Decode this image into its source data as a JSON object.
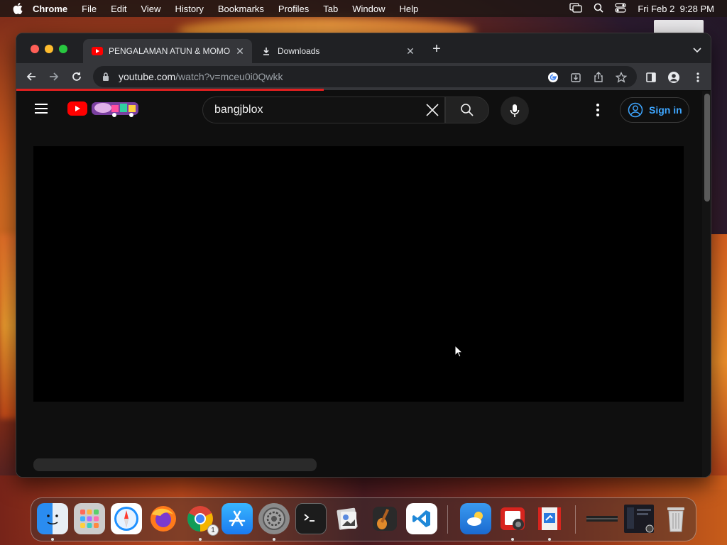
{
  "menubar": {
    "app": "Chrome",
    "items": [
      "File",
      "Edit",
      "View",
      "History",
      "Bookmarks",
      "Profiles",
      "Tab",
      "Window",
      "Help"
    ],
    "clock": "Fri Feb 2  9:28 PM"
  },
  "browser": {
    "tabs": [
      {
        "title": "PENGALAMAN ATUN & MOMO",
        "icon": "youtube-icon",
        "active": true
      },
      {
        "title": "Downloads",
        "icon": "download-icon",
        "active": false
      }
    ],
    "url_host": "youtube.com",
    "url_path": "/watch?v=mceu0i0Qwkk"
  },
  "youtube": {
    "search_value": "bangjblox",
    "signin_label": "Sign in"
  },
  "dock": {
    "items": [
      {
        "name": "finder",
        "running": true
      },
      {
        "name": "launchpad",
        "running": false
      },
      {
        "name": "safari",
        "running": false
      },
      {
        "name": "firefox",
        "running": false
      },
      {
        "name": "chrome",
        "running": true,
        "badge": "1"
      },
      {
        "name": "app-store",
        "running": false
      },
      {
        "name": "system-settings",
        "running": true
      },
      {
        "name": "terminal",
        "running": false
      },
      {
        "name": "preview",
        "running": false
      },
      {
        "name": "garageband",
        "running": false
      },
      {
        "name": "vscode",
        "running": false
      },
      {
        "name": "weather",
        "running": false
      },
      {
        "name": "photo-booth",
        "running": true
      },
      {
        "name": "remote-desktop",
        "running": true
      }
    ]
  },
  "colors": {
    "accent_blue": "#3ea6ff",
    "youtube_red": "#ff0000",
    "progress_red": "#e02020"
  }
}
